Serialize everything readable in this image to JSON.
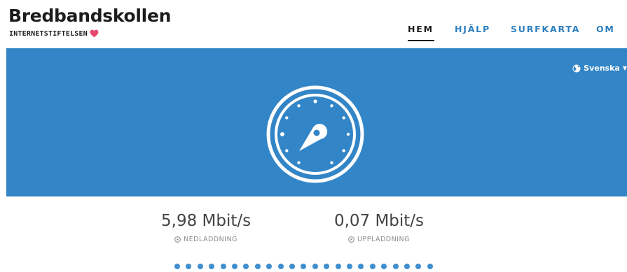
{
  "brand": {
    "title": "Bredbandskollen",
    "subtitle": "INTERNETSTIFTELSEN",
    "heart_color": "#e8476d"
  },
  "nav": {
    "items": [
      {
        "label": "HEM",
        "active": true
      },
      {
        "label": "HJÄLP",
        "active": false
      },
      {
        "label": "SURFKARTA",
        "active": false
      },
      {
        "label": "OM",
        "active": false
      }
    ]
  },
  "hero": {
    "background": "#3285c6",
    "language": "Svenska",
    "gauge_icon": "speedometer-icon"
  },
  "results": {
    "download": {
      "value": "5,98 Mbit/s",
      "label": "NEDLADDNING",
      "icon": "download-circle-icon"
    },
    "upload": {
      "value": "0,07 Mbit/s",
      "label": "UPPLADDNING",
      "icon": "upload-circle-icon"
    }
  },
  "progress": {
    "dot_count": 23,
    "dot_color": "#3f8fd0"
  }
}
